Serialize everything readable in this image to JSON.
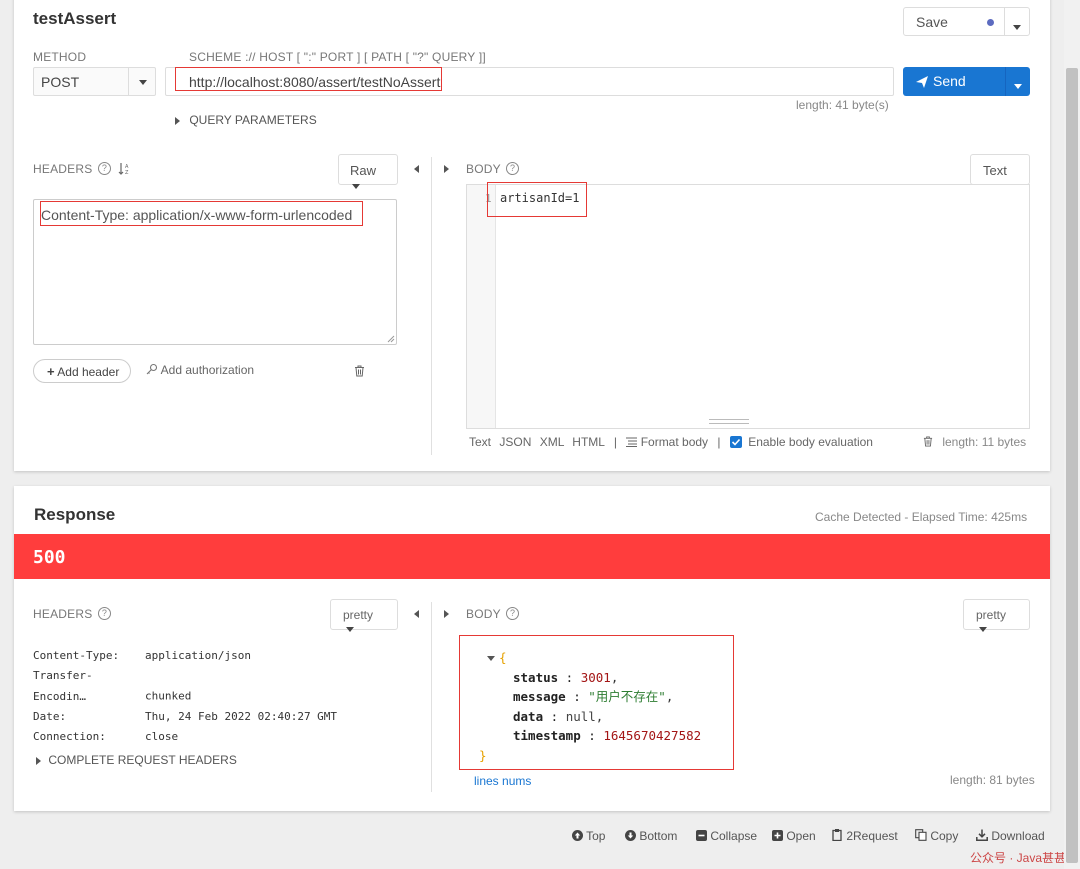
{
  "request": {
    "title": "testAssert",
    "save_label": "Save",
    "method_label": "METHOD",
    "method_value": "POST",
    "url_label": "SCHEME :// HOST [ \":\" PORT ] [ PATH [ \"?\" QUERY ]]",
    "url_value": "http://localhost:8080/assert/testNoAssert",
    "send_label": "Send",
    "url_length": "length: 41 byte(s)",
    "query_params_label": "QUERY PARAMETERS",
    "headers_label": "HEADERS",
    "headers_mode": "Raw",
    "headers_text": "Content-Type: application/x-www-form-urlencoded",
    "add_header_label": "Add header",
    "add_auth_label": "Add authorization",
    "body_label": "BODY",
    "body_mode": "Text",
    "body_line_number": "1",
    "body_text": "artisanId=1",
    "body_formats": [
      "Text",
      "JSON",
      "XML",
      "HTML"
    ],
    "format_body_label": "Format body",
    "enable_eval_label": "Enable body evaluation",
    "enable_eval_checked": true,
    "body_length": "length: 11 bytes"
  },
  "response": {
    "title": "Response",
    "cache_info": "Cache Detected - Elapsed Time: 425ms",
    "status_code": "500",
    "status_color": "#ff3d3d",
    "headers_label": "HEADERS",
    "headers_mode": "pretty",
    "headers": [
      {
        "name": "Content-Type:",
        "value": "application/json"
      },
      {
        "name": "Transfer-Encodin…",
        "value": "chunked"
      },
      {
        "name": "Date:",
        "value": "Thu, 24 Feb 2022 02:40:27 GMT"
      },
      {
        "name": "Connection:",
        "value": "close"
      }
    ],
    "complete_headers_label": "COMPLETE REQUEST HEADERS",
    "body_label": "BODY",
    "body_mode": "pretty",
    "json": {
      "open_brace": "{",
      "close_brace": "}",
      "status_key": "status",
      "status_val": "3001",
      "message_key": "message",
      "message_val": "\"用户不存在\"",
      "data_key": "data",
      "data_val": "null",
      "timestamp_key": "timestamp",
      "timestamp_val": "1645670427582"
    },
    "lines_nums_label": "lines nums",
    "body_length": "length: 81 bytes"
  },
  "footer": {
    "top": "Top",
    "bottom": "Bottom",
    "collapse": "Collapse",
    "open": "Open",
    "to_request": "2Request",
    "copy": "Copy",
    "download": "Download",
    "watermark": "公众号 · Java甚甚"
  },
  "colors": {
    "accent": "#1976d2",
    "error": "#ff3d3d",
    "annotation": "#e53935"
  }
}
